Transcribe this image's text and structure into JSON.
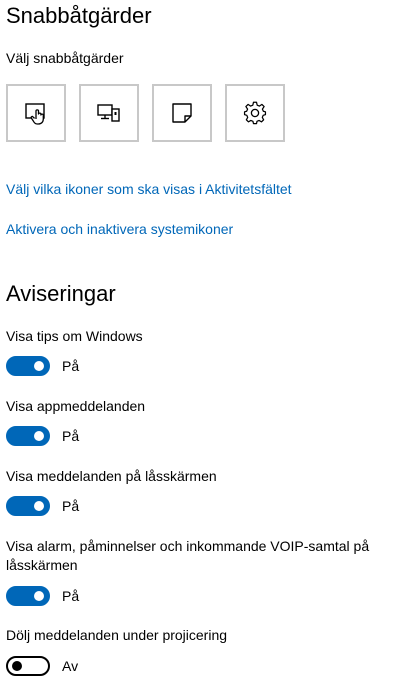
{
  "quick_actions": {
    "title": "Snabbåtgärder",
    "subtitle": "Välj snabbåtgärder",
    "tiles": [
      {
        "icon": "tablet-mode-icon"
      },
      {
        "icon": "connect-device-icon"
      },
      {
        "icon": "note-icon"
      },
      {
        "icon": "settings-gear-icon"
      }
    ],
    "link_taskbar_icons": "Välj vilka ikoner som ska visas i Aktivitetsfältet",
    "link_system_icons": "Aktivera och inaktivera systemikoner"
  },
  "notifications": {
    "title": "Aviseringar",
    "settings": [
      {
        "label": "Visa tips om Windows",
        "state": "På",
        "on": true
      },
      {
        "label": "Visa appmeddelanden",
        "state": "På",
        "on": true
      },
      {
        "label": "Visa meddelanden på låsskärmen",
        "state": "På",
        "on": true
      },
      {
        "label": "Visa alarm, påminnelser och inkommande VOIP-samtal på låsskärmen",
        "state": "På",
        "on": true
      },
      {
        "label": "Dölj meddelanden under projicering",
        "state": "Av",
        "on": false
      }
    ]
  },
  "colors": {
    "accent": "#0067b8",
    "tile_border": "#c8c8c8"
  }
}
